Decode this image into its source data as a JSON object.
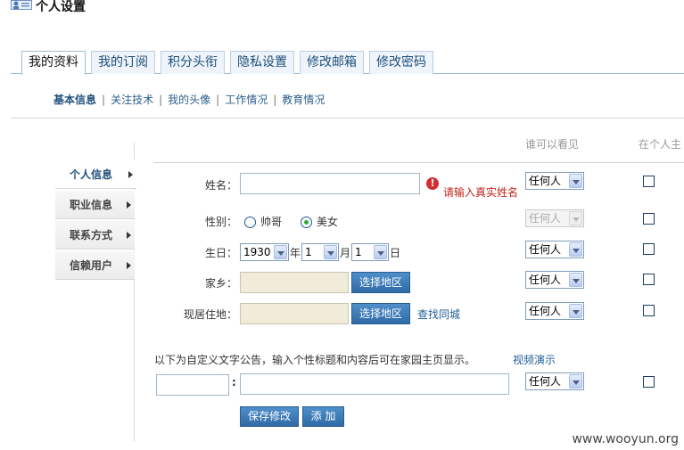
{
  "page": {
    "title": "个人设置",
    "icon": "user-card-icon"
  },
  "tabs": [
    {
      "label": "我的资料",
      "active": true
    },
    {
      "label": "我的订阅",
      "active": false
    },
    {
      "label": "积分头衔",
      "active": false
    },
    {
      "label": "隐私设置",
      "active": false
    },
    {
      "label": "修改邮箱",
      "active": false
    },
    {
      "label": "修改密码",
      "active": false
    }
  ],
  "subnav": [
    {
      "label": "基本信息",
      "current": true
    },
    {
      "label": "关注技术",
      "current": false
    },
    {
      "label": "我的头像",
      "current": false
    },
    {
      "label": "工作情况",
      "current": false
    },
    {
      "label": "教育情况",
      "current": false
    }
  ],
  "sidebar": {
    "items": [
      {
        "label": "个人信息",
        "active": true
      },
      {
        "label": "职业信息",
        "active": false
      },
      {
        "label": "联系方式",
        "active": false
      },
      {
        "label": "信赖用户",
        "active": false
      }
    ]
  },
  "columns": {
    "visibility": "谁可以看见",
    "show_on_home": "在个人主"
  },
  "form": {
    "name": {
      "label": "姓名：",
      "value": "",
      "warning": "请输入真实姓名"
    },
    "gender": {
      "label": "性别：",
      "option_male": "帅哥",
      "option_female": "美女",
      "selected": "美女"
    },
    "birthday": {
      "label": "生日：",
      "year": "1930",
      "year_unit": "年",
      "month": "1",
      "month_unit": "月",
      "day": "1",
      "day_unit": "日"
    },
    "hometown": {
      "label": "家乡：",
      "value": "",
      "button": "选择地区"
    },
    "residence": {
      "label": "现居住地：",
      "value": "",
      "button": "选择地区",
      "link": "查找同城"
    },
    "custom": {
      "notice": "以下为自定义文字公告，输入个性标题和内容后可在家园主页显示。",
      "demo_link": "视频演示",
      "title_value": "",
      "separator": ":",
      "content_value": ""
    }
  },
  "visibility_selects": [
    "任何人",
    "任何人",
    "任何人",
    "任何人",
    "任何人",
    "任何人"
  ],
  "actions": {
    "save": "保存修改",
    "add": "添 加"
  },
  "watermark": "www.wooyun.org"
}
